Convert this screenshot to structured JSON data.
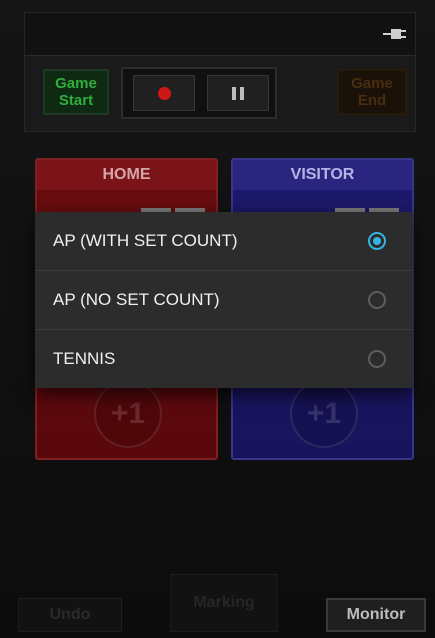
{
  "controls": {
    "game_start": "Game\nStart",
    "game_end": "Game\nEnd"
  },
  "teams": {
    "home": "HOME",
    "visitor": "VISITOR",
    "plus_one": "+1"
  },
  "dialog": {
    "options": [
      {
        "label": "AP (WITH SET COUNT)",
        "selected": true
      },
      {
        "label": "AP (NO SET COUNT)",
        "selected": false
      },
      {
        "label": "TENNIS",
        "selected": false
      }
    ]
  },
  "bottom": {
    "undo": "Undo",
    "marking": "Marking",
    "monitor": "Monitor"
  },
  "colors": {
    "radio_selected": "#33b5e5",
    "home": "#6a0d10",
    "visitor": "#1e1a6e",
    "game_start_text": "#2fae3c"
  }
}
